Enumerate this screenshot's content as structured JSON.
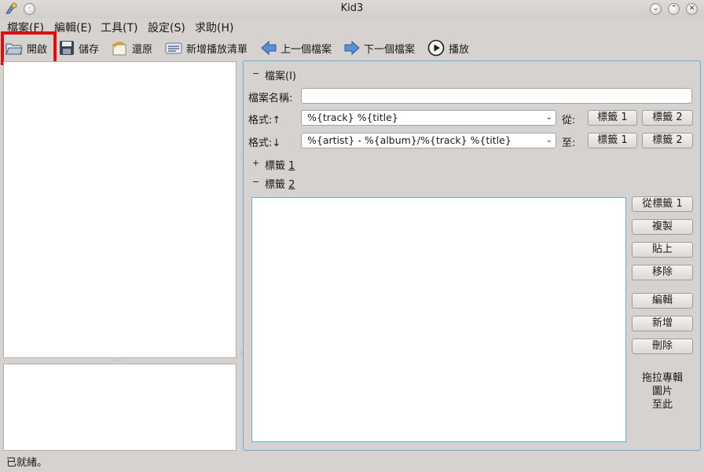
{
  "window": {
    "title": "Kid3"
  },
  "menu": [
    {
      "label": "檔案(F)",
      "underline": "F"
    },
    {
      "label": "編輯(E)",
      "underline": "E"
    },
    {
      "label": "工具(T)",
      "underline": "T"
    },
    {
      "label": "設定(S)",
      "underline": "S"
    },
    {
      "label": "求助(H)",
      "underline": "H"
    }
  ],
  "toolbar": {
    "open": "開啟",
    "save": "儲存",
    "revert": "還原",
    "new_playlist": "新增播放清單",
    "previous_file": "上一個檔案",
    "next_file": "下一個檔案",
    "play": "播放"
  },
  "file_section": {
    "header": "檔案(I)",
    "filename_label": "檔案名稱:",
    "filename_value": "",
    "format_up_label": "格式:↑",
    "format_up_value": "%{track} %{title}",
    "from_label": "從:",
    "format_down_label": "格式:↓",
    "format_down_value": "%{artist} - %{album}/%{track} %{title}",
    "to_label": "至:",
    "tag1_button": "標籤 1",
    "tag2_button": "標籤 2"
  },
  "tag1_section": {
    "label": "標籤",
    "number": "1"
  },
  "tag2_section": {
    "label": "標籤",
    "number": "2",
    "buttons": {
      "from_tag1": "從標籤 1",
      "copy": "複製",
      "paste": "貼上",
      "remove": "移除",
      "edit": "編輯",
      "add": "新增",
      "delete": "刪除"
    },
    "cover_drop_text": [
      "拖拉專輯",
      "圖片",
      "至此"
    ]
  },
  "status": {
    "text": "已就緒。"
  },
  "colors": {
    "window_bg": "#d6d2d0",
    "focus_frame": "#58b4e4",
    "highlight_box": "#e30b0b"
  }
}
